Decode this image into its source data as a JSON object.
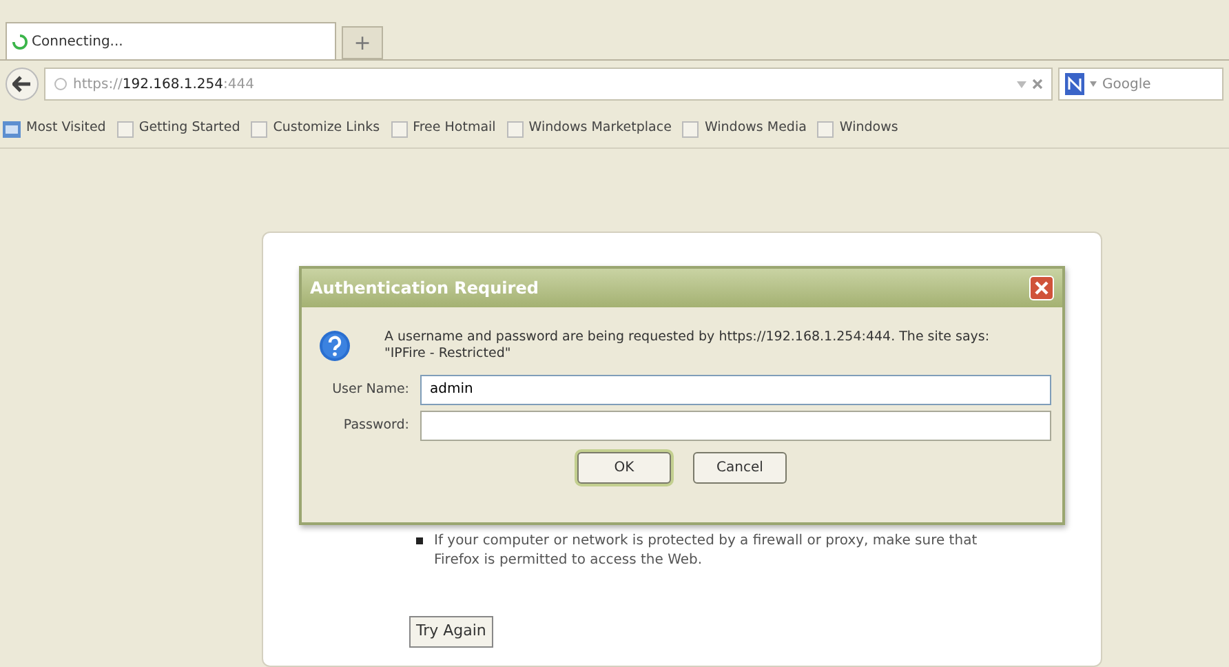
{
  "tabs": [
    {
      "label": "Connecting...",
      "selected": true,
      "loading": true
    }
  ],
  "new_tab": {
    "label": "+"
  },
  "address_bar": {
    "scheme": "https://",
    "host": "192.168.1.254",
    "port": ":444"
  },
  "search": {
    "engine": "Google"
  },
  "bookmarks": [
    {
      "label": "Most Visited",
      "kind": "folder"
    },
    {
      "label": "Getting Started",
      "kind": "page"
    },
    {
      "label": "Customize Links",
      "kind": "page"
    },
    {
      "label": "Free Hotmail",
      "kind": "page"
    },
    {
      "label": "Windows Marketplace",
      "kind": "page"
    },
    {
      "label": "Windows Media",
      "kind": "page"
    },
    {
      "label": "Windows",
      "kind": "page"
    }
  ],
  "error_page": {
    "bullet": "If your computer or network is protected by a firewall or proxy, make sure that Firefox is permitted to access the Web.",
    "button": "Try Again"
  },
  "dialog": {
    "title": "Authentication Required",
    "message": "A username and password are being requested by https://192.168.1.254:444. The site says:",
    "realm": "\"IPFire - Restricted\"",
    "fields": [
      {
        "label": "User Name:",
        "value": "admin",
        "focused": true
      },
      {
        "label": "Password:",
        "focused": false
      }
    ],
    "buttons": [
      {
        "label": "OK",
        "default": true
      },
      {
        "label": "Cancel",
        "default": false
      }
    ]
  }
}
